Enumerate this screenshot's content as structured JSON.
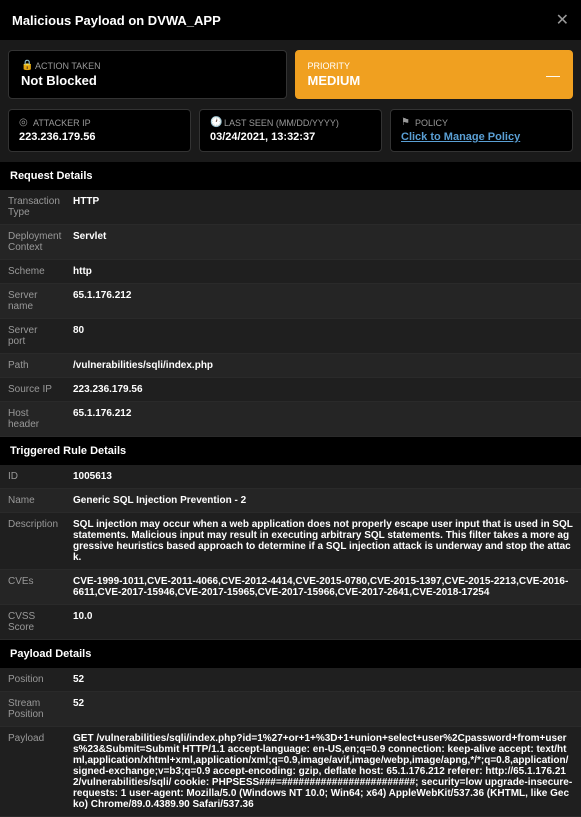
{
  "header": {
    "title": "Malicious Payload on DVWA_APP"
  },
  "action": {
    "label": "ACTION TAKEN",
    "value": "Not Blocked"
  },
  "priority": {
    "label": "PRIORITY",
    "value": "MEDIUM"
  },
  "info_cards": {
    "attacker_ip": {
      "label": "ATTACKER IP",
      "value": "223.236.179.56"
    },
    "last_seen": {
      "label": "LAST SEEN (MM/DD/YYYY)",
      "value": "03/24/2021, 13:32:37"
    },
    "policy": {
      "label": "POLICY",
      "value": "Click to Manage Policy"
    }
  },
  "sections": {
    "request": {
      "title": "Request Details",
      "rows": [
        {
          "label": "Transaction Type",
          "value": "HTTP"
        },
        {
          "label": "Deployment Context",
          "value": "Servlet"
        },
        {
          "label": "Scheme",
          "value": "http"
        },
        {
          "label": "Server name",
          "value": "65.1.176.212"
        },
        {
          "label": "Server port",
          "value": "80"
        },
        {
          "label": "Path",
          "value": "/vulnerabilities/sqli/index.php"
        },
        {
          "label": "Source IP",
          "value": "223.236.179.56"
        },
        {
          "label": "Host header",
          "value": "65.1.176.212"
        }
      ]
    },
    "rule": {
      "title": "Triggered Rule Details",
      "rows": [
        {
          "label": "ID",
          "value": "1005613"
        },
        {
          "label": "Name",
          "value": "Generic SQL Injection Prevention - 2"
        },
        {
          "label": "Description",
          "value": "SQL injection may occur when a web application does not properly escape user input that is used in SQL statements. Malicious input may result in executing arbitrary SQL statements. This filter takes a more aggressive heuristics based approach to determine if a SQL injection attack is underway and stop the attack."
        },
        {
          "label": "CVEs",
          "value": "CVE-1999-1011,CVE-2011-4066,CVE-2012-4414,CVE-2015-0780,CVE-2015-1397,CVE-2015-2213,CVE-2016-6611,CVE-2017-15946,CVE-2017-15965,CVE-2017-15966,CVE-2017-2641,CVE-2018-17254"
        },
        {
          "label": "CVSS Score",
          "value": "10.0"
        }
      ]
    },
    "payload": {
      "title": "Payload Details",
      "rows": [
        {
          "label": "Position",
          "value": "52"
        },
        {
          "label": "Stream Position",
          "value": "52"
        },
        {
          "label": "Payload",
          "value": "GET /vulnerabilities/sqli/index.php?id=1%27+or+1+%3D+1+union+select+user%2Cpassword+from+users%23&Submit=Submit HTTP/1.1 accept-language: en-US,en;q=0.9 connection: keep-alive accept: text/html,application/xhtml+xml,application/xml;q=0.9,image/avif,image/webp,image/apng,*/*;q=0.8,application/signed-exchange;v=b3;q=0.9 accept-encoding: gzip, deflate host: 65.1.176.212 referer: http://65.1.176.212/vulnerabilities/sqli/ cookie: PHPSESS###=########################; security=low upgrade-insecure-requests: 1 user-agent: Mozilla/5.0 (Windows NT 10.0; Win64; x64) AppleWebKit/537.36 (KHTML, like Gecko) Chrome/89.0.4389.90 Safari/537.36"
        }
      ]
    }
  }
}
